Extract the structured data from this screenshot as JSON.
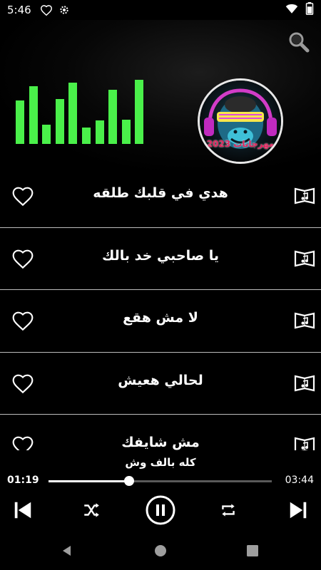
{
  "status_bar": {
    "time": "5:46",
    "icons": [
      "heart-outline-icon",
      "settings-icon",
      "wifi-icon",
      "battery-icon"
    ]
  },
  "header": {
    "search_icon": "search-icon",
    "equalizer": {
      "levels": [
        0.68,
        0.9,
        0.3,
        0.7,
        0.96,
        0.26,
        0.37,
        0.84,
        0.38,
        1.0
      ],
      "color": "#4af04a"
    },
    "logo_text": "مهرجانات 2023"
  },
  "songs": [
    {
      "title": "هدي في قلبك طلقه"
    },
    {
      "title": "يا صاحبي خد بالك"
    },
    {
      "title": "لا مش هقع"
    },
    {
      "title": "لحالي هعيش"
    },
    {
      "title": "مش شايفك"
    }
  ],
  "player": {
    "now_playing": "كله بالف وش",
    "current_time": "01:19",
    "total_time": "03:44",
    "progress": 0.36,
    "controls": [
      "skip-previous-icon",
      "shuffle-icon",
      "pause-icon",
      "repeat-icon",
      "skip-next-icon"
    ]
  },
  "nav_bar": {
    "icons": [
      "back-icon",
      "home-icon",
      "recents-icon"
    ]
  },
  "colors": {
    "accent": "#4af04a",
    "background": "#000000",
    "divider": "#bdbdbd"
  }
}
